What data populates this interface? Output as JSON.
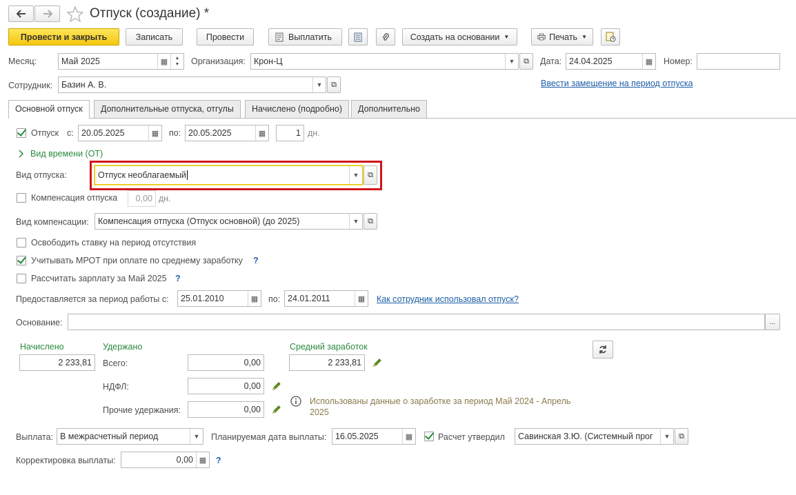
{
  "window": {
    "title": "Отпуск (создание) *"
  },
  "toolbar": {
    "post_close": "Провести и закрыть",
    "save": "Записать",
    "post": "Провести",
    "pay": "Выплатить",
    "create_based": "Создать на основании",
    "print": "Печать"
  },
  "header": {
    "month_label": "Месяц:",
    "month_value": "Май 2025",
    "org_label": "Организация:",
    "org_value": "Крон-Ц",
    "date_label": "Дата:",
    "date_value": "24.04.2025",
    "number_label": "Номер:",
    "number_value": "",
    "employee_label": "Сотрудник:",
    "employee_value": "Базин А. В.",
    "replacement_link": "Ввести замещение на период отпуска"
  },
  "tabs": [
    "Основной отпуск",
    "Дополнительные отпуска, отгулы",
    "Начислено (подробно)",
    "Дополнительно"
  ],
  "vacation": {
    "checkbox_label": "Отпуск",
    "from_label": "с:",
    "from_value": "20.05.2025",
    "to_label": "по:",
    "to_value": "20.05.2025",
    "days_value": "1",
    "days_unit": "дн.",
    "time_type_link": "Вид времени (ОТ)",
    "type_label": "Вид отпуска:",
    "type_value": "Отпуск необлагаемый",
    "compensation_label": "Компенсация отпуска",
    "compensation_days": "0,00",
    "compensation_unit": "дн.",
    "comp_type_label": "Вид компенсации:",
    "comp_type_value": "Компенсация отпуска (Отпуск основной) (до 2025)",
    "free_rate_label": "Освободить ставку на период отсутствия",
    "mrot_label": "Учитывать МРОТ при оплате по среднему заработку",
    "calc_salary_label": "Рассчитать зарплату за Май 2025",
    "period_label": "Предоставляется за период работы с:",
    "period_from": "25.01.2010",
    "period_to_label": "по:",
    "period_to": "24.01.2011",
    "how_used_link": "Как сотрудник использовал отпуск?",
    "basis_label": "Основание:",
    "basis_value": ""
  },
  "totals": {
    "accrued_label": "Начислено",
    "accrued_value": "2 233,81",
    "withheld_label": "Удержано",
    "total_label": "Всего:",
    "total_value": "0,00",
    "ndfl_label": "НДФЛ:",
    "ndfl_value": "0,00",
    "other_label": "Прочие удержания:",
    "other_value": "0,00",
    "avg_label": "Средний заработок",
    "avg_value": "2 233,81",
    "info_text_1": "Использованы данные о заработке за период Май 2024 - Апрель",
    "info_text_2": "2025"
  },
  "payment": {
    "label": "Выплата:",
    "value": "В межрасчетный период",
    "planned_label": "Планируемая дата выплаты:",
    "planned_value": "16.05.2025",
    "approved_label": "Расчет утвердил",
    "approved_value": "Савинская З.Ю. (Системный прог",
    "correction_label": "Корректировка выплаты:",
    "correction_value": "0,00"
  },
  "colors": {
    "primary": "#f5c70d",
    "highlight": "#d0151a",
    "link": "#1c5ea5",
    "green": "#2b8a3e"
  }
}
